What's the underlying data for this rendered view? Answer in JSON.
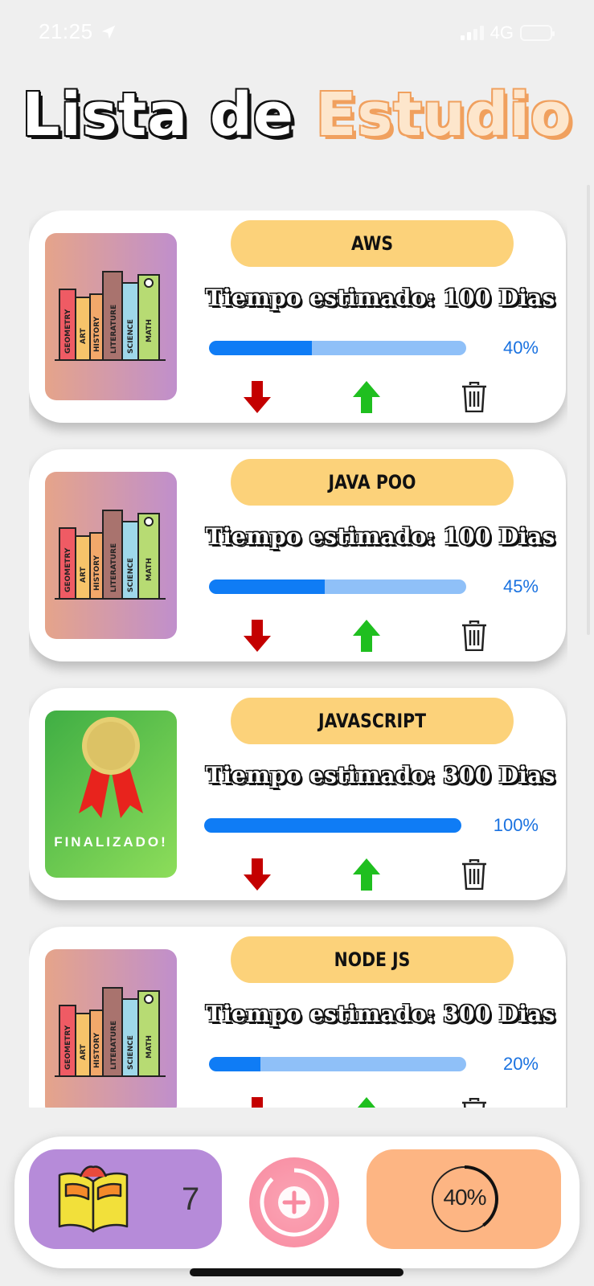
{
  "status_bar": {
    "time": "21:25",
    "network": "4G"
  },
  "header": {
    "title_part1": "Lista de",
    "title_part2": "Estudio"
  },
  "courses": [
    {
      "name": "AWS",
      "estimate": "Tiempo estimado: 100 Dias",
      "progress_label": "40%",
      "progress": 0.4,
      "thumbnail": "books-icon"
    },
    {
      "name": "JAVA POO",
      "estimate": "Tiempo estimado: 100 Dias",
      "progress_label": "45%",
      "progress": 0.45,
      "thumbnail": "books-icon"
    },
    {
      "name": "JAVASCRIPT",
      "estimate": "Tiempo estimado: 300 Dias",
      "progress_label": "100%",
      "progress": 1.0,
      "thumbnail": "medal-icon",
      "thumbnail_label": "FINALIZADO!"
    },
    {
      "name": "NODE JS",
      "estimate": "Tiempo estimado: 300 Dias",
      "progress_label": "20%",
      "progress": 0.2,
      "thumbnail": "books-icon"
    }
  ],
  "book_spines": [
    "GEOMETRY",
    "ART",
    "HISTORY",
    "LITERATURE",
    "SCIENCE",
    "MATH"
  ],
  "bottom_bar": {
    "count": "7",
    "overall_progress_label": "40%",
    "overall_progress": 0.4
  },
  "colors": {
    "pill": "#fcd27a",
    "progress_fill": "#0f7cf5",
    "progress_track": "#8fc0f8",
    "down_arrow": "#c40000",
    "up_arrow": "#1fbf1f",
    "count_panel": "#b68bd9",
    "add_button": "#f88aa0",
    "progress_panel": "#fdb583"
  }
}
